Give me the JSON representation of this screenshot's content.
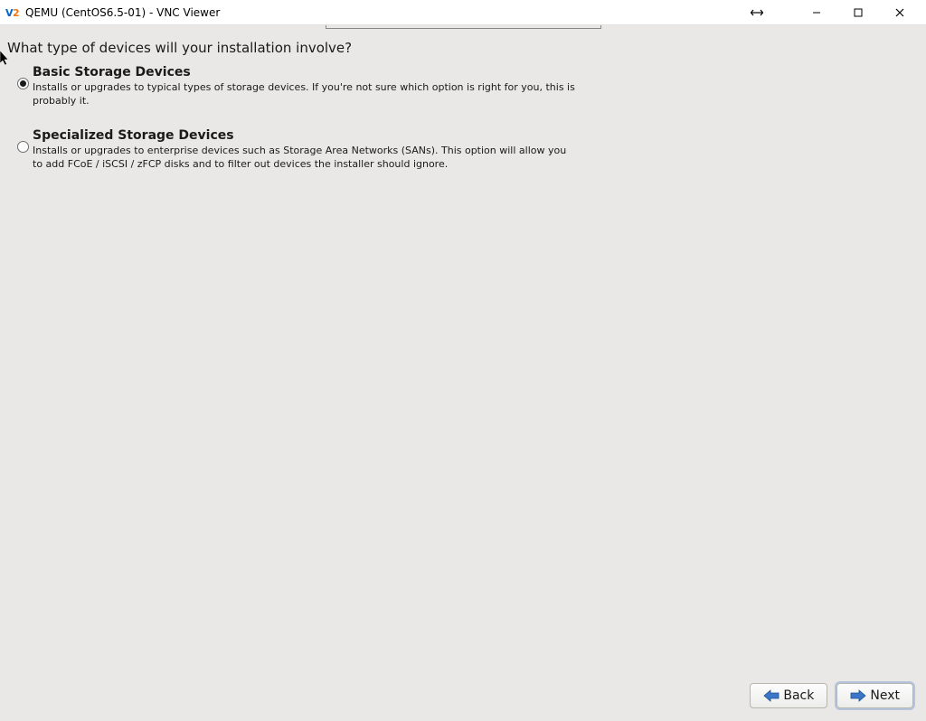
{
  "window": {
    "title": "QEMU (CentOS6.5-01) - VNC Viewer"
  },
  "installer": {
    "question": "What type of devices will your installation involve?",
    "options": [
      {
        "title": "Basic Storage Devices",
        "description": "Installs or upgrades to typical types of storage devices.  If you're not sure which option is right for you, this is probably it.",
        "selected": true
      },
      {
        "title": "Specialized Storage Devices",
        "description": "Installs or upgrades to enterprise devices such as Storage Area Networks (SANs). This option will allow you to add FCoE / iSCSI / zFCP disks and to filter out devices the installer should ignore.",
        "selected": false
      }
    ],
    "buttons": {
      "back": "Back",
      "next": "Next"
    }
  }
}
